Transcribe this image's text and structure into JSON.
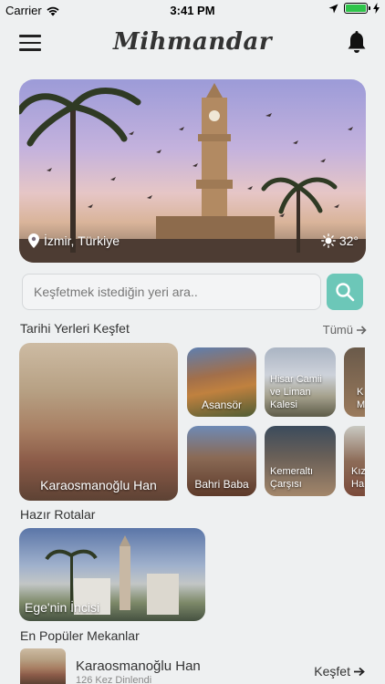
{
  "status_bar": {
    "carrier": "Carrier",
    "time": "3:41 PM"
  },
  "app": {
    "title": "Mihmandar"
  },
  "hero": {
    "location": "İzmir, Türkiye",
    "temperature": "32°"
  },
  "search": {
    "placeholder": "Keşfetmek istediğin yeri ara.."
  },
  "historic": {
    "title": "Tarihi Yerleri Keşfet",
    "see_all": "Tümü",
    "featured": "Karaosmanoğlu Han",
    "places": [
      "Asansör",
      "Hisar Camii ve Liman Kalesi",
      "K M",
      "Bahri Baba",
      "Kemeraltı Çarşısı",
      "Kız Ha"
    ]
  },
  "routes": {
    "title": "Hazır Rotalar",
    "items": [
      "Ege'nin İncisi"
    ]
  },
  "popular": {
    "title": "En Popüler Mekanlar",
    "name": "Karaosmanoğlu Han",
    "subtitle": "126 Kez Dinlendi",
    "action": "Keşfet"
  },
  "colors": {
    "accent": "#6cc7b8",
    "background": "#eef0f1"
  }
}
